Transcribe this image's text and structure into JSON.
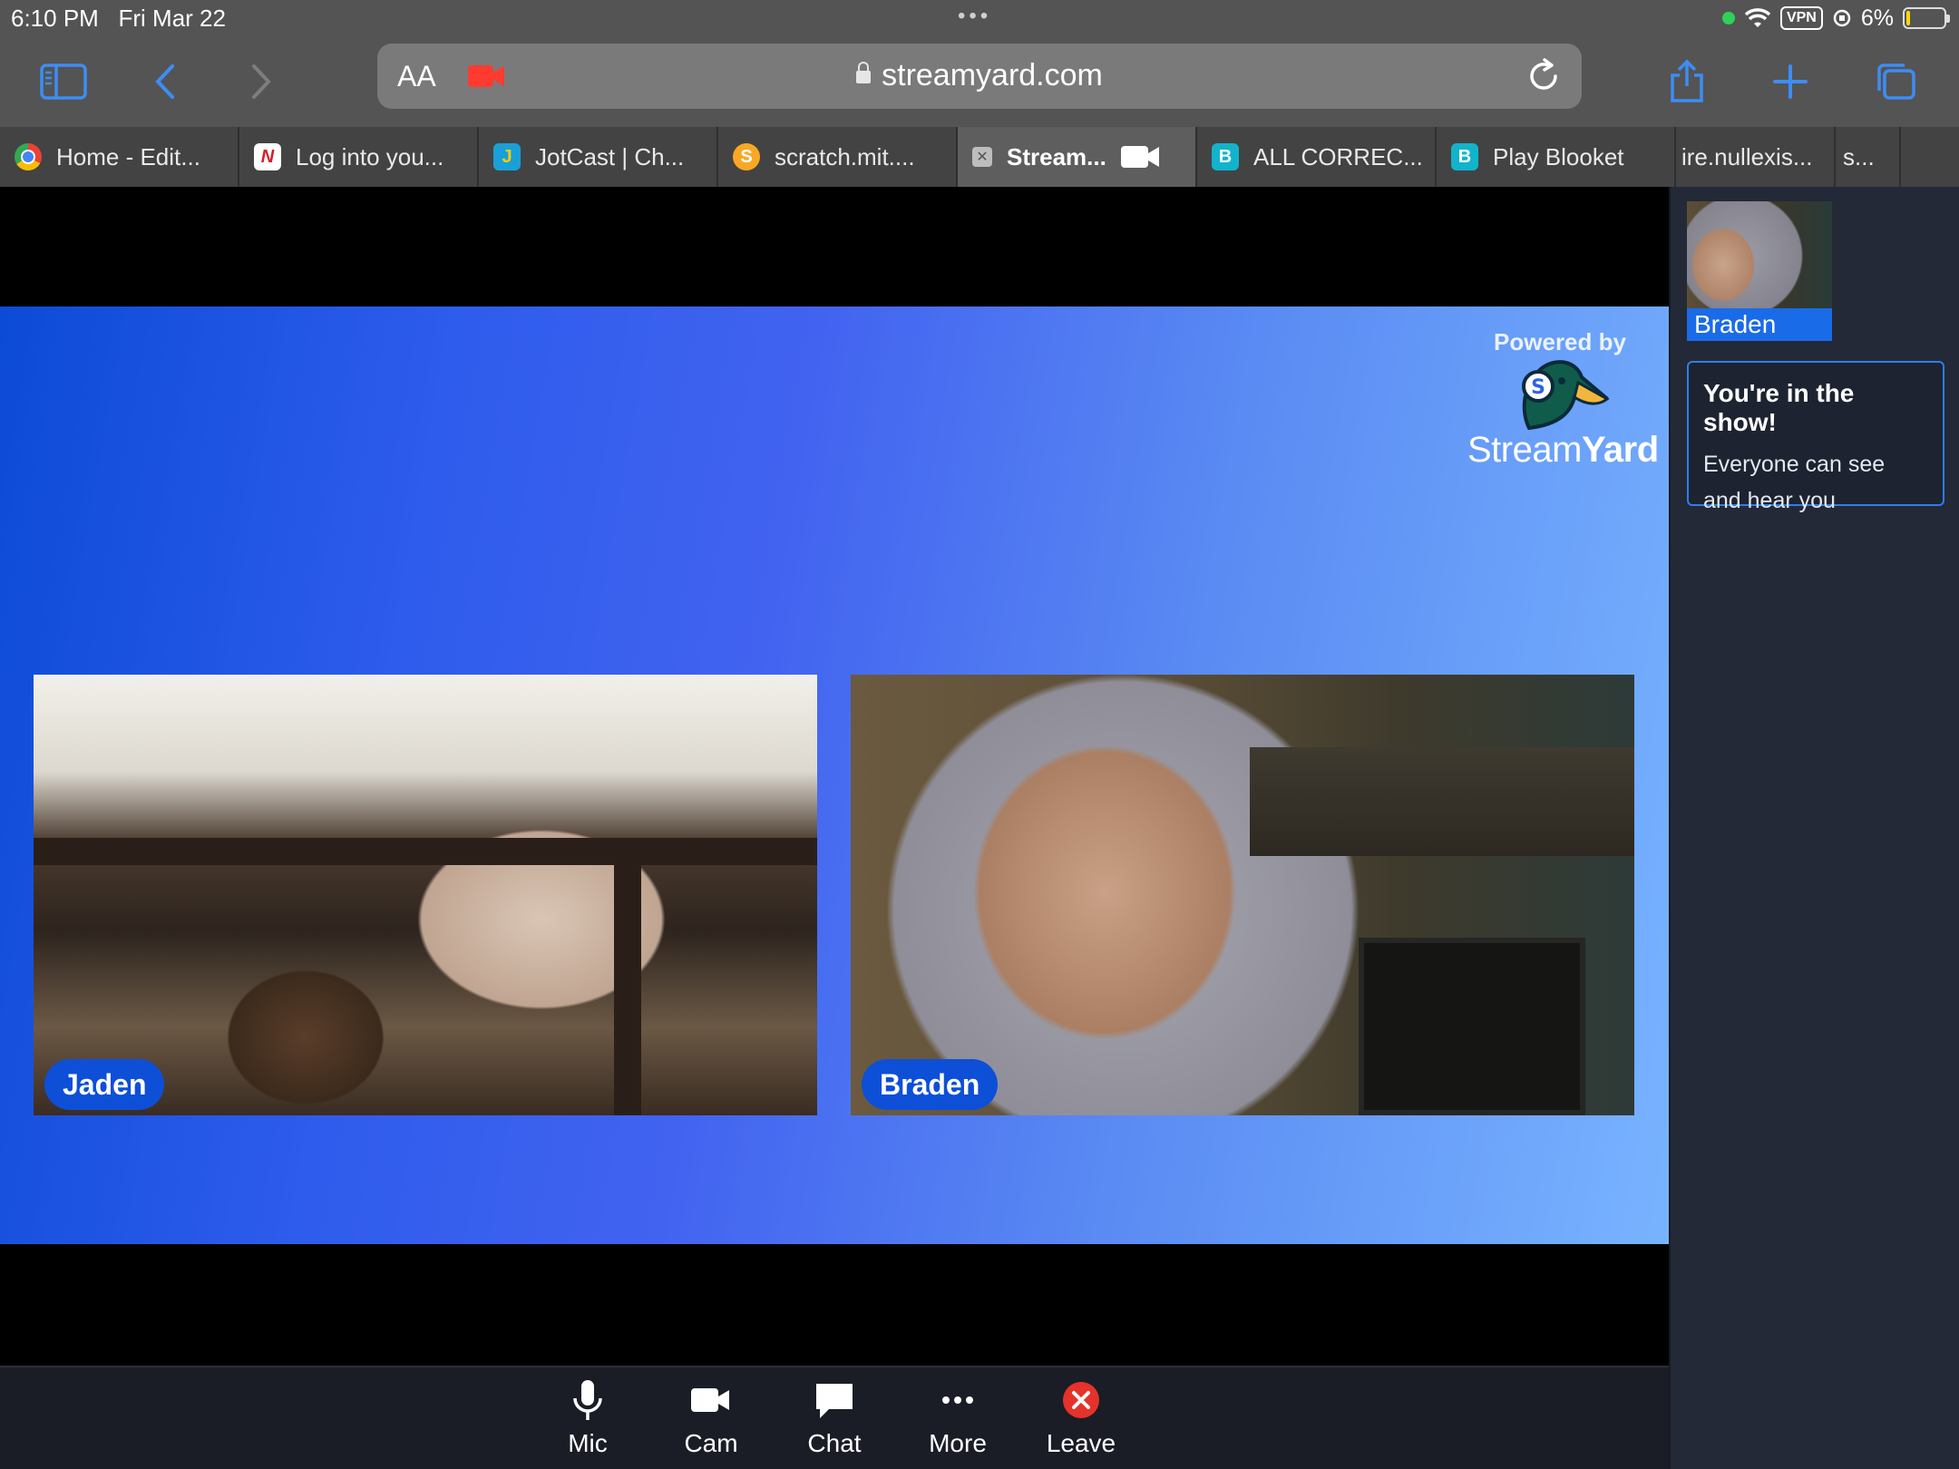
{
  "status_bar": {
    "time": "6:10 PM",
    "date": "Fri Mar 22",
    "vpn": "VPN",
    "battery": "6%"
  },
  "toolbar": {
    "text_size_label": "AA",
    "url": "streamyard.com"
  },
  "tabs": [
    {
      "label": "Home - Edit...",
      "icon": "chrome-favicon"
    },
    {
      "label": "Log into you...",
      "icon": "newsela-favicon",
      "icon_text": "N"
    },
    {
      "label": "JotCast | Ch...",
      "icon": "jotcast-favicon",
      "icon_text": "J"
    },
    {
      "label": "scratch.mit....",
      "icon": "scratch-favicon",
      "icon_text": "S"
    },
    {
      "label": "Stream...",
      "icon": "close-icon",
      "icon_text": "✕",
      "active": true
    },
    {
      "label": "ALL CORREC...",
      "icon": "blooket-favicon",
      "icon_text": "B"
    },
    {
      "label": "Play Blooket",
      "icon": "blooket-favicon",
      "icon_text": "B"
    },
    {
      "label": "ire.nullexis..."
    },
    {
      "label": "s..."
    }
  ],
  "stage": {
    "powered_by": "Powered by",
    "logo_text_light": "Stream",
    "logo_text_bold": "Yard",
    "participants": [
      {
        "name": "Jaden"
      },
      {
        "name": "Braden"
      }
    ]
  },
  "sidebar": {
    "self_name": "Braden",
    "notice_title": "You're in the show!",
    "notice_body": "Everyone can see and hear you"
  },
  "controls": [
    {
      "label": "Mic",
      "icon": "microphone-icon"
    },
    {
      "label": "Cam",
      "icon": "camera-icon"
    },
    {
      "label": "Chat",
      "icon": "chat-icon"
    },
    {
      "label": "More",
      "icon": "more-icon"
    },
    {
      "label": "Leave",
      "icon": "leave-icon"
    }
  ],
  "colors": {
    "accent": "#0e4fd8",
    "leave_red": "#e5322b",
    "recording_red": "#ff3b30"
  }
}
